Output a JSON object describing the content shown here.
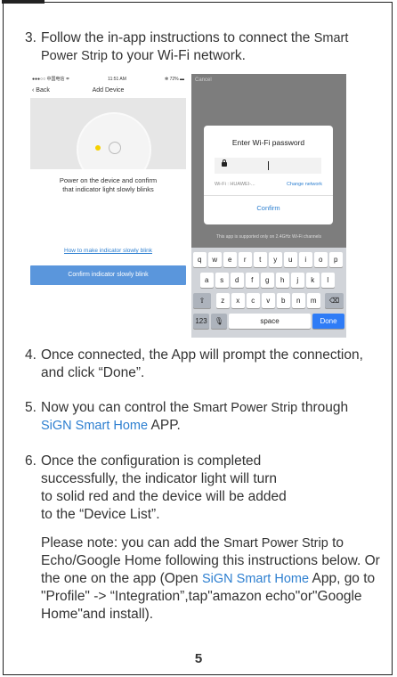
{
  "step3": {
    "num": "3.",
    "text_a": "Follow the in-app instructions to connect the",
    "device": "Smart Power Strip",
    "text_b": " to your Wi-Fi network."
  },
  "phone1": {
    "status_left": "●●●○○ 中国电信 ≑",
    "status_time": "11:51 AM",
    "status_right": "✻ 72% ▬",
    "back": "‹ Back",
    "title": "Add Device",
    "instruction_1": "Power on the device and confirm",
    "instruction_2": "that indicator light slowly blinks",
    "link": "How to make indicator slowly blink",
    "button": "Confirm indicator slowly blink"
  },
  "phone2": {
    "cancel": "Cancel",
    "dialog_title": "Enter Wi-Fi password",
    "cursor": "I",
    "wifi_label": "Wi-Fi : HUAWEI-...",
    "change_network": "Change network",
    "confirm": "Confirm",
    "note": "This app is supported only on 2.4GHz Wi-Fi channels",
    "keys_row1": [
      "q",
      "w",
      "e",
      "r",
      "t",
      "y",
      "u",
      "i",
      "o",
      "p"
    ],
    "keys_row2": [
      "a",
      "s",
      "d",
      "f",
      "g",
      "h",
      "j",
      "k",
      "l"
    ],
    "keys_row3": [
      "z",
      "x",
      "c",
      "v",
      "b",
      "n",
      "m"
    ],
    "shift": "⇧",
    "delete": "⌫",
    "num_key": "123",
    "mic": "🎙",
    "space": "space",
    "done": "Done"
  },
  "step4": {
    "num": "4.",
    "text": "Once connected, the App will prompt the connection, and click “Done”."
  },
  "step5": {
    "num": "5.",
    "text_a": "Now you can control the ",
    "device": "Smart Power Strip",
    "text_b": " through ",
    "app": "SiGN Smart Home",
    "text_c": " APP."
  },
  "step6": {
    "num": "6.",
    "text": "Once the configuration is completed successfully, the indicator light will turn to solid red and the device will be added to the “Device List”."
  },
  "note": {
    "a": "Please note: you can add the ",
    "device": "Smart Power Strip",
    "b": " to Echo/Google Home following this instructions below. Or the one on the app (Open ",
    "app": "SiGN Smart Home",
    "c": " App, go to \"Profile\" -> “Integration”,tap\"amazon echo\"or\"Google Home\"and install)."
  },
  "page_number": "5"
}
